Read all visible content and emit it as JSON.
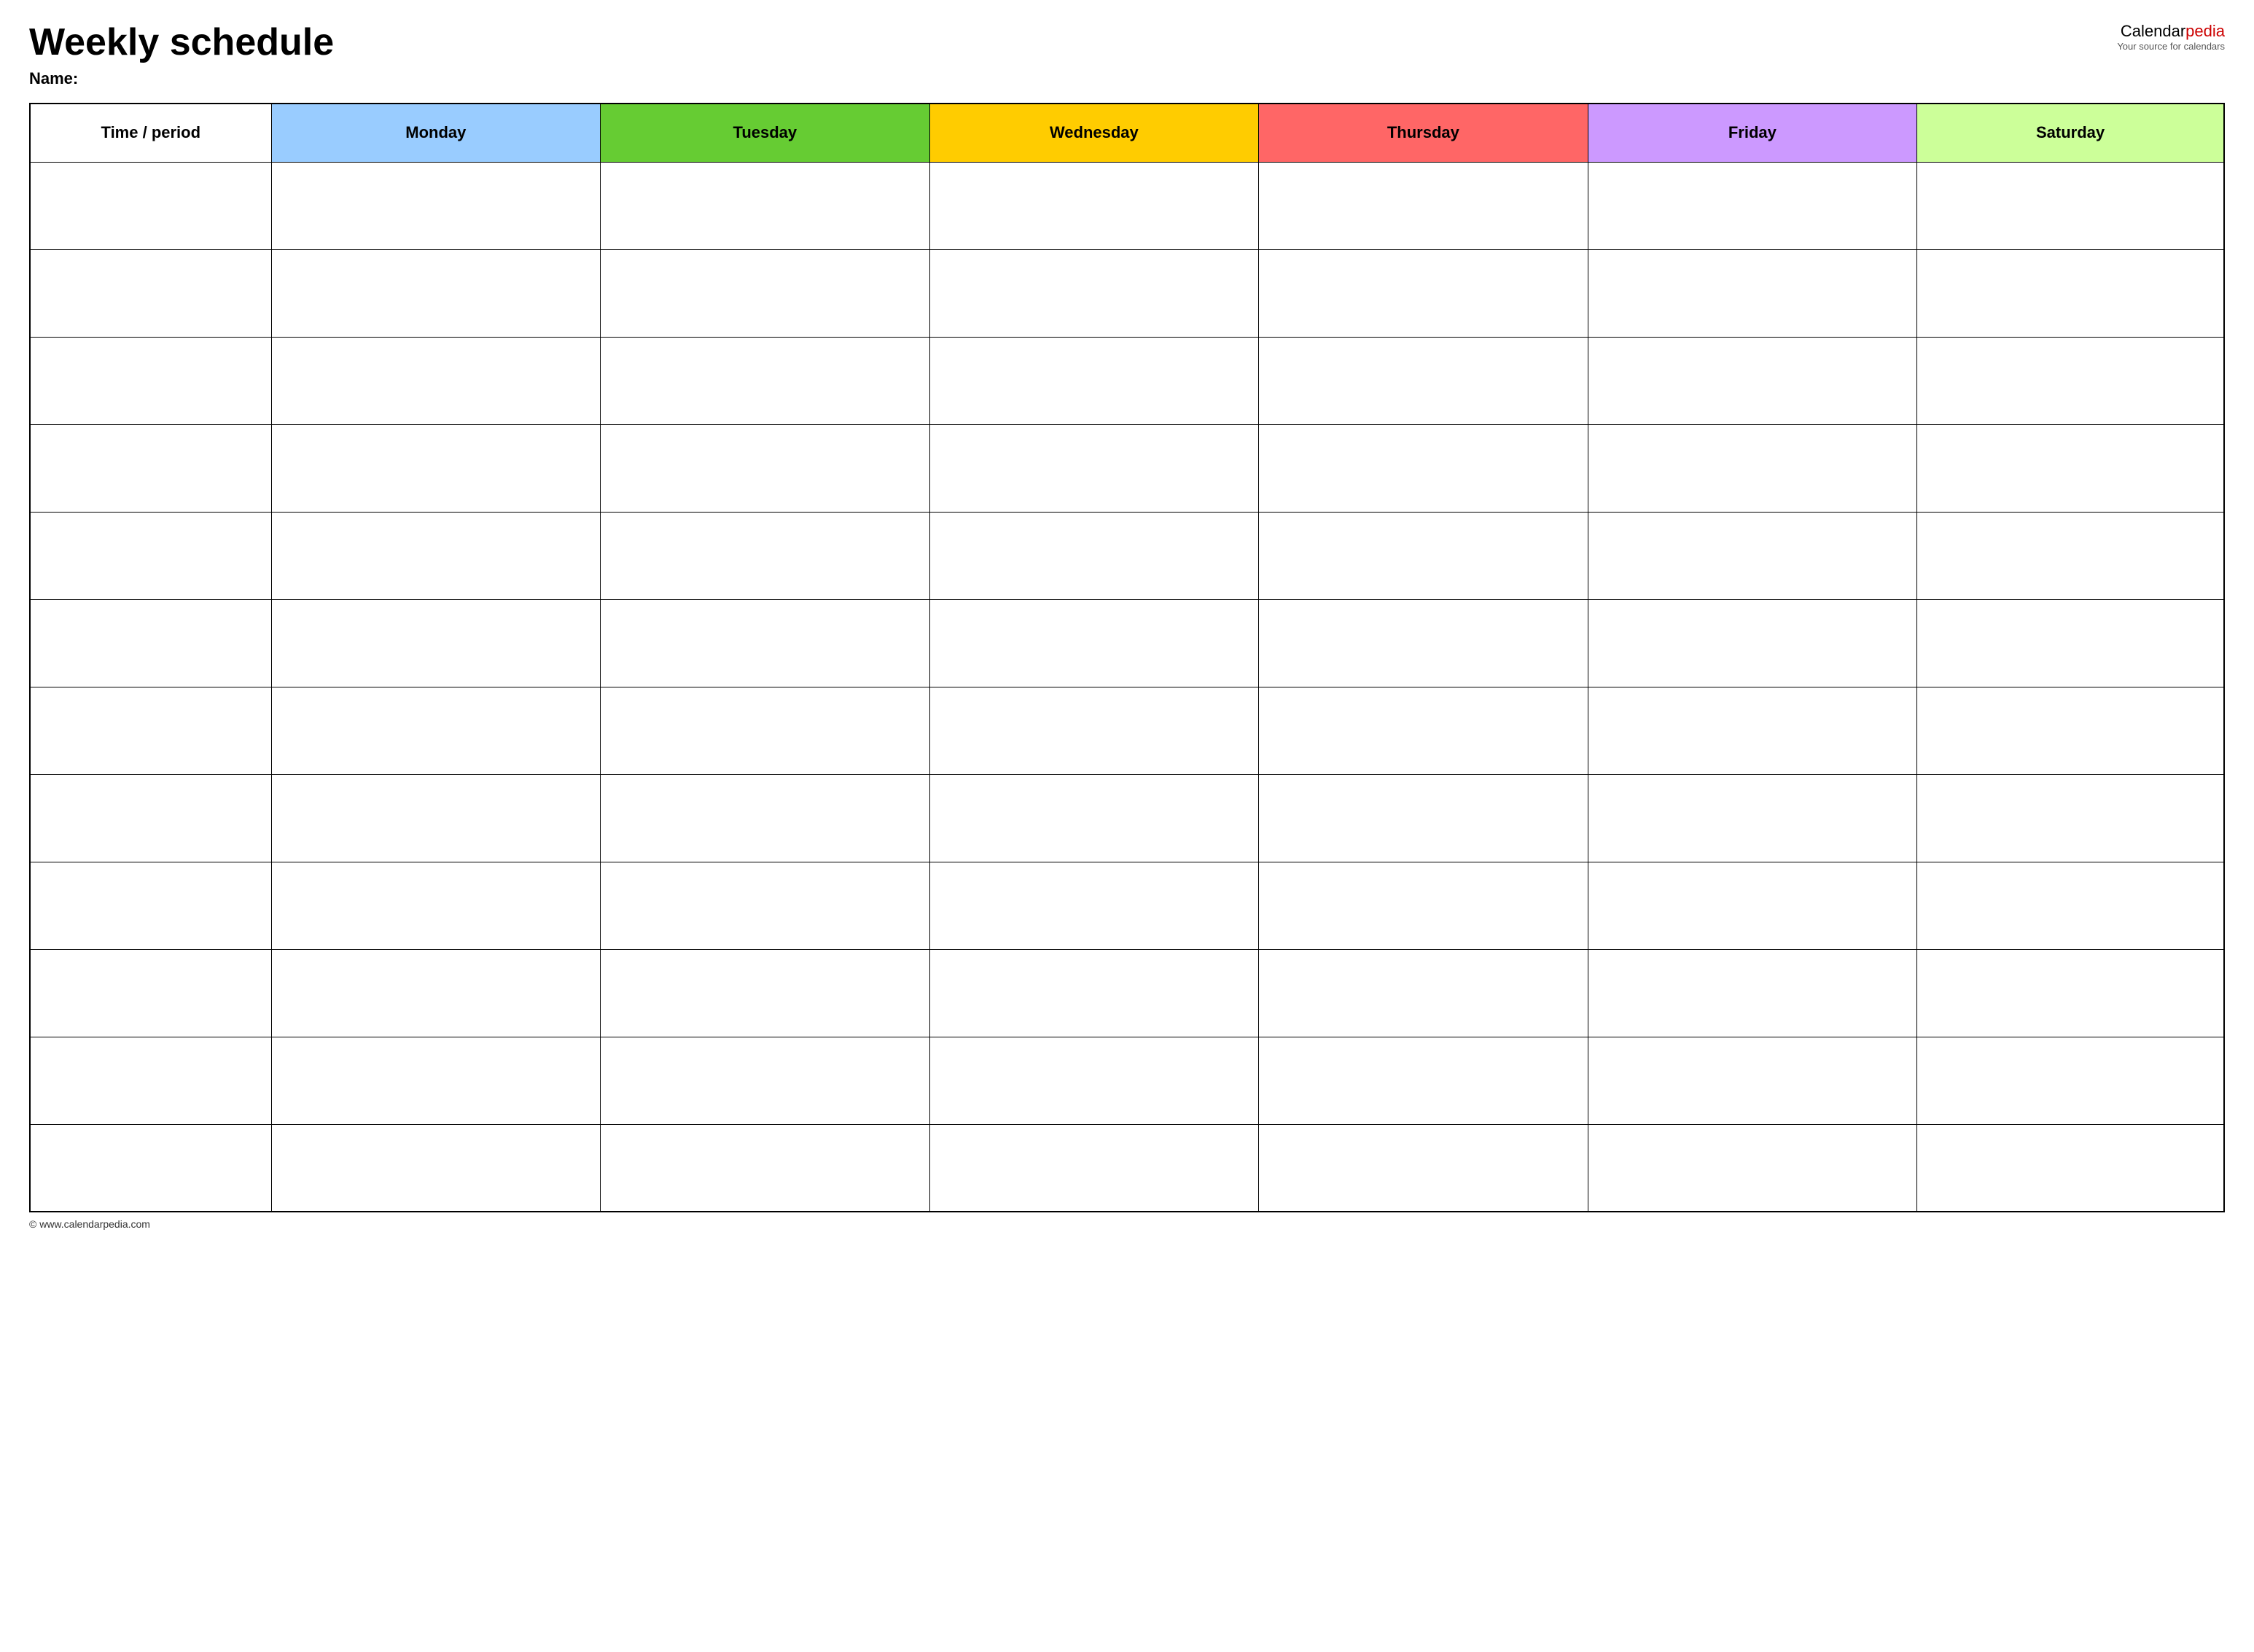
{
  "header": {
    "title": "Weekly schedule",
    "name_label": "Name:",
    "logo_calendar": "Calendar",
    "logo_pedia": "pedia",
    "logo_tagline": "Your source for calendars"
  },
  "table": {
    "columns": [
      {
        "id": "time",
        "label": "Time / period",
        "class": "col-time"
      },
      {
        "id": "monday",
        "label": "Monday",
        "class": "col-monday"
      },
      {
        "id": "tuesday",
        "label": "Tuesday",
        "class": "col-tuesday"
      },
      {
        "id": "wednesday",
        "label": "Wednesday",
        "class": "col-wednesday"
      },
      {
        "id": "thursday",
        "label": "Thursday",
        "class": "col-thursday"
      },
      {
        "id": "friday",
        "label": "Friday",
        "class": "col-friday"
      },
      {
        "id": "saturday",
        "label": "Saturday",
        "class": "col-saturday"
      }
    ],
    "row_count": 12
  },
  "footer": {
    "url": "© www.calendarpedia.com"
  }
}
